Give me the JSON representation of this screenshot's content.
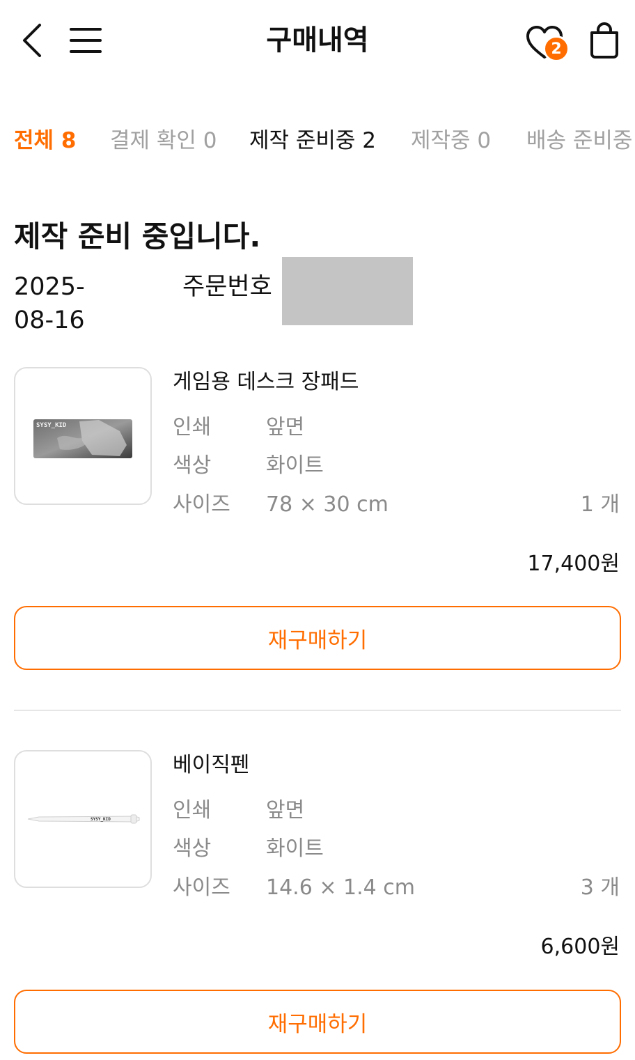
{
  "header": {
    "title": "구매내역",
    "wishlist_count": "2"
  },
  "tabs": [
    {
      "label": "전체 8"
    },
    {
      "label": "결제 확인 0"
    },
    {
      "label": "제작 준비중 2"
    },
    {
      "label": "제작중 0"
    },
    {
      "label": "배송 준비중"
    }
  ],
  "order": {
    "status_title": "제작 준비 중입니다.",
    "date": "2025-08-16",
    "order_no_label": "주문번호"
  },
  "items": [
    {
      "name": "게임용 데스크 장패드",
      "image_text": "SYSY_KID",
      "options": [
        {
          "label": "인쇄",
          "value": "앞면"
        },
        {
          "label": "색상",
          "value": "화이트"
        },
        {
          "label": "사이즈",
          "value": "78 × 30 cm"
        }
      ],
      "quantity": "1 개",
      "price": "17,400원",
      "rebuy_label": "재구매하기"
    },
    {
      "name": "베이직펜",
      "image_text": "SYSY_KID",
      "options": [
        {
          "label": "인쇄",
          "value": "앞면"
        },
        {
          "label": "색상",
          "value": "화이트"
        },
        {
          "label": "사이즈",
          "value": "14.6 × 1.4 cm"
        }
      ],
      "quantity": "3 개",
      "price": "6,600원",
      "rebuy_label": "재구매하기"
    }
  ],
  "colors": {
    "accent": "#ff6d00",
    "muted_text": "#8a8a8a",
    "tab_inactive": "#a0a0a0",
    "mask": "#c4c4c4"
  },
  "icons": {
    "back": "chevron-left-icon",
    "menu": "hamburger-menu-icon",
    "wishlist": "heart-icon",
    "cart": "shopping-bag-icon"
  }
}
